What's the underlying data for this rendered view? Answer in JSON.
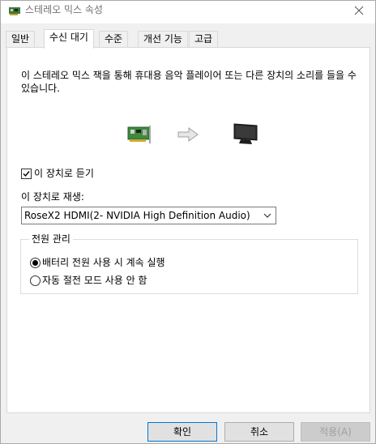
{
  "window": {
    "title": "스테레오 믹스 속성"
  },
  "tabs": [
    {
      "label": "일반"
    },
    {
      "label": "수신 대기"
    },
    {
      "label": "수준"
    },
    {
      "label": "개선 기능"
    },
    {
      "label": "고급"
    }
  ],
  "listen": {
    "description": "이 스테레오 믹스 잭을 통해 휴대용 음악 플레이어 또는 다른 장치의 소리를 들을 수 있습니다.",
    "checkbox_label": "이 장치로 듣기",
    "checkbox_checked": true,
    "playback_label": "이 장치로 재생:",
    "playback_device": "RoseX2 HDMI(2- NVIDIA High Definition Audio)"
  },
  "power": {
    "group_title": "전원 관리",
    "options": [
      {
        "label": "배터리 전원 사용 시 계속 실행",
        "selected": true
      },
      {
        "label": "자동 절전 모드 사용 안 함",
        "selected": false
      }
    ]
  },
  "buttons": {
    "ok": "확인",
    "cancel": "취소",
    "apply": "적용(A)"
  },
  "icons": {
    "title": "sound-card-icon",
    "close": "close-icon",
    "source": "sound-card-icon",
    "arrow": "arrow-right-icon",
    "target": "monitor-icon"
  }
}
